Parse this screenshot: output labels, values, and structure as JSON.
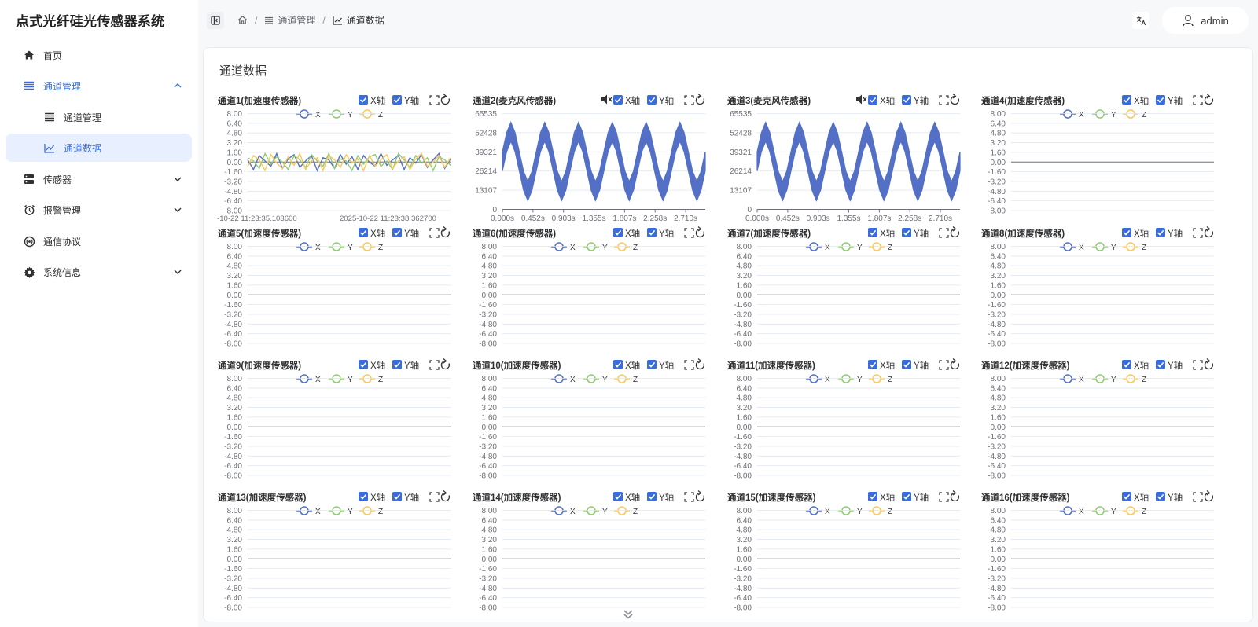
{
  "app": {
    "title": "点式光纤硅光传感器系统"
  },
  "sidebar": {
    "items": [
      {
        "label": "首页",
        "icon": "home-icon",
        "state": "normal",
        "chevron": ""
      },
      {
        "label": "通道管理",
        "icon": "list-icon",
        "state": "open",
        "chevron": "up"
      },
      {
        "label": "通道管理",
        "icon": "list-icon",
        "state": "sub",
        "chevron": ""
      },
      {
        "label": "通道数据",
        "icon": "line-chart-icon",
        "state": "active",
        "chevron": ""
      },
      {
        "label": "传感器",
        "icon": "server-icon",
        "state": "normal",
        "chevron": "down"
      },
      {
        "label": "报警管理",
        "icon": "alarm-clock-icon",
        "state": "normal",
        "chevron": "down"
      },
      {
        "label": "通信协议",
        "icon": "broadcast-icon",
        "state": "normal",
        "chevron": ""
      },
      {
        "label": "系统信息",
        "icon": "gear-icon",
        "state": "normal",
        "chevron": "down"
      }
    ]
  },
  "header": {
    "breadcrumb": [
      {
        "label": "",
        "icon": "home-icon"
      },
      {
        "label": "通道管理",
        "icon": "list-icon"
      },
      {
        "label": "通道数据",
        "icon": "line-chart-icon"
      }
    ],
    "user": "admin",
    "lang_icon": "translate-icon"
  },
  "page": {
    "title": "通道数据"
  },
  "controls": {
    "x_axis_label": "X轴",
    "y_axis_label": "Y轴"
  },
  "colors": {
    "accent": "#3a6ddb",
    "series_x": "#5470c6",
    "series_y": "#91cc75",
    "series_z": "#fac858",
    "axis": "#6e7079",
    "grid": "#e0e6f1"
  },
  "accel_legend": [
    "X",
    "Y",
    "Z"
  ],
  "accel_yticks": [
    "8.00",
    "6.40",
    "4.80",
    "3.20",
    "1.60",
    "0.00",
    "-1.60",
    "-3.20",
    "-4.80",
    "-6.40",
    "-8.00"
  ],
  "mic_yticks": [
    "65535",
    "52428",
    "39321",
    "26214",
    "13107",
    "0"
  ],
  "mic_xticks": [
    "0.000s",
    "0.452s",
    "0.903s",
    "1.355s",
    "1.807s",
    "2.258s",
    "2.710s"
  ],
  "channels": [
    {
      "id": 1,
      "title": "通道1(加速度传感器)",
      "type": "accel",
      "x_checked": true,
      "y_checked": true,
      "muted": false,
      "has_data": true,
      "xticks": [
        "-10-22 11:23:35.103600",
        "2025-10-22 11:23:38.362700"
      ]
    },
    {
      "id": 2,
      "title": "通道2(麦克风传感器)",
      "type": "mic",
      "x_checked": true,
      "y_checked": true,
      "muted": true,
      "has_data": true
    },
    {
      "id": 3,
      "title": "通道3(麦克风传感器)",
      "type": "mic",
      "x_checked": true,
      "y_checked": true,
      "muted": true,
      "has_data": true
    },
    {
      "id": 4,
      "title": "通道4(加速度传感器)",
      "type": "accel",
      "x_checked": true,
      "y_checked": true,
      "muted": false,
      "has_data": false
    },
    {
      "id": 5,
      "title": "通道5(加速度传感器)",
      "type": "accel",
      "x_checked": true,
      "y_checked": true,
      "muted": false,
      "has_data": false
    },
    {
      "id": 6,
      "title": "通道6(加速度传感器)",
      "type": "accel",
      "x_checked": true,
      "y_checked": true,
      "muted": false,
      "has_data": false
    },
    {
      "id": 7,
      "title": "通道7(加速度传感器)",
      "type": "accel",
      "x_checked": true,
      "y_checked": true,
      "muted": false,
      "has_data": false
    },
    {
      "id": 8,
      "title": "通道8(加速度传感器)",
      "type": "accel",
      "x_checked": true,
      "y_checked": true,
      "muted": false,
      "has_data": false
    },
    {
      "id": 9,
      "title": "通道9(加速度传感器)",
      "type": "accel",
      "x_checked": true,
      "y_checked": true,
      "muted": false,
      "has_data": false
    },
    {
      "id": 10,
      "title": "通道10(加速度传感器)",
      "type": "accel",
      "x_checked": true,
      "y_checked": true,
      "muted": false,
      "has_data": false
    },
    {
      "id": 11,
      "title": "通道11(加速度传感器)",
      "type": "accel",
      "x_checked": true,
      "y_checked": true,
      "muted": false,
      "has_data": false
    },
    {
      "id": 12,
      "title": "通道12(加速度传感器)",
      "type": "accel",
      "x_checked": true,
      "y_checked": true,
      "muted": false,
      "has_data": false
    },
    {
      "id": 13,
      "title": "通道13(加速度传感器)",
      "type": "accel",
      "x_checked": true,
      "y_checked": true,
      "muted": false,
      "has_data": false
    },
    {
      "id": 14,
      "title": "通道14(加速度传感器)",
      "type": "accel",
      "x_checked": true,
      "y_checked": true,
      "muted": false,
      "has_data": false
    },
    {
      "id": 15,
      "title": "通道15(加速度传感器)",
      "type": "accel",
      "x_checked": true,
      "y_checked": true,
      "muted": false,
      "has_data": false
    },
    {
      "id": 16,
      "title": "通道16(加速度传感器)",
      "type": "accel",
      "x_checked": true,
      "y_checked": true,
      "muted": false,
      "has_data": false
    }
  ],
  "chart_data": [
    {
      "type": "line",
      "title": "通道1(加速度传感器)",
      "series": [
        {
          "name": "X",
          "values": [
            0.1,
            -0.35,
            0.3,
            0.05,
            -0.2,
            0.4,
            -0.3,
            0.15,
            0.35,
            -0.25,
            0.05,
            0.3,
            -0.4,
            0.2,
            0.1,
            -0.3,
            0.35,
            -0.1,
            0.25,
            -0.35,
            0.3,
            0.0,
            -0.2,
            0.4,
            -0.15,
            0.1,
            0.3,
            -0.35,
            0.2,
            -0.05,
            0.35,
            -0.25,
            0.1,
            0.4,
            -0.3,
            0.15
          ]
        },
        {
          "name": "Y",
          "values": [
            0.2,
            0.05,
            -0.3,
            0.4,
            -0.1,
            0.25,
            0.0,
            -0.35,
            0.3,
            0.1,
            -0.25,
            0.35,
            0.05,
            -0.2,
            0.4,
            -0.3,
            0.15,
            0.05,
            -0.4,
            0.3,
            -0.1,
            0.25,
            0.35,
            -0.2,
            0.05,
            -0.35,
            0.4,
            0.1,
            -0.25,
            0.3,
            -0.05,
            0.2,
            -0.4,
            0.25,
            0.1,
            -0.15
          ]
        },
        {
          "name": "Z",
          "values": [
            -0.2,
            0.3,
            0.1,
            -0.4,
            0.35,
            -0.05,
            -0.3,
            0.25,
            -0.15,
            0.4,
            -0.35,
            0.05,
            0.2,
            -0.4,
            0.3,
            0.1,
            -0.25,
            0.35,
            -0.05,
            0.15,
            -0.4,
            0.3,
            -0.2,
            0.1,
            0.35,
            -0.3,
            0.05,
            0.25,
            -0.35,
            0.15,
            0.4,
            -0.2,
            0.0,
            0.3,
            -0.25,
            0.2
          ]
        }
      ],
      "ylim": [
        -8,
        8
      ]
    },
    {
      "type": "line",
      "title": "通道2(麦克风传感器)",
      "series": [
        {
          "values": [
            32768,
            46000,
            53000,
            46000,
            32768,
            19500,
            12500,
            19500,
            32768,
            46000,
            53000,
            46000,
            32768,
            19500,
            12500,
            19500,
            32768,
            46000,
            53000,
            46000,
            32768,
            19500,
            12500,
            19500,
            32768,
            46000,
            53000,
            46000,
            32768,
            19500,
            12500,
            19500,
            32768,
            46000,
            53000,
            46000,
            32768,
            19500,
            12500,
            19500,
            32768,
            46000,
            53000,
            46000,
            32768,
            19500,
            12500,
            19500,
            32768
          ]
        }
      ],
      "ylim": [
        0,
        65535
      ],
      "xlim": [
        0,
        3.0
      ]
    },
    {
      "type": "line",
      "title": "通道3(麦克风传感器)",
      "series": [
        {
          "values": [
            32768,
            46000,
            53000,
            46000,
            32768,
            19500,
            12500,
            19500,
            32768,
            46000,
            53000,
            46000,
            32768,
            19500,
            12500,
            19500,
            32768,
            46000,
            53000,
            46000,
            32768,
            19500,
            12500,
            19500,
            32768,
            46000,
            53000,
            46000,
            32768,
            19500,
            12500,
            19500,
            32768,
            46000,
            53000,
            46000,
            32768,
            19500,
            12500,
            19500,
            32768,
            46000,
            53000,
            46000,
            32768,
            19500,
            12500,
            19500,
            32768
          ]
        }
      ],
      "ylim": [
        0,
        65535
      ],
      "xlim": [
        0,
        3.0
      ]
    }
  ]
}
